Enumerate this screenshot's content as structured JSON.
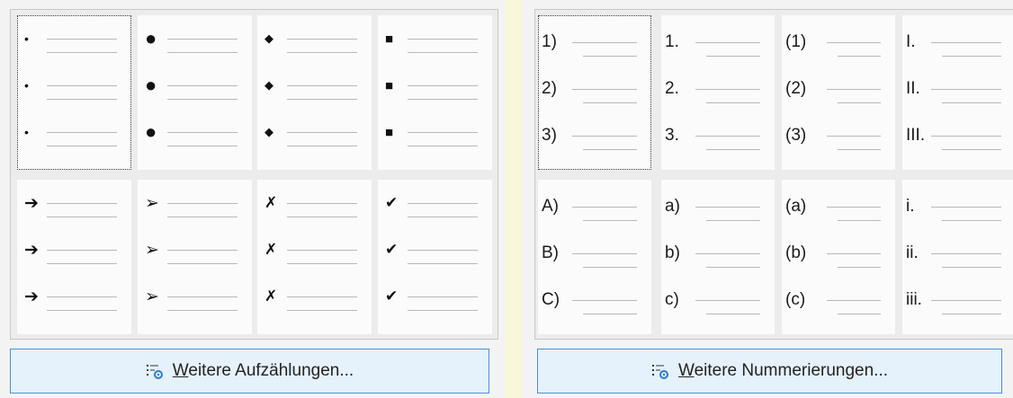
{
  "bullets": {
    "rows": [
      [
        {
          "name": "small-bullet",
          "marker": "•"
        },
        {
          "name": "large-bullet",
          "marker": "●"
        },
        {
          "name": "diamond-bullet",
          "marker": "◆"
        },
        {
          "name": "square-bullet",
          "marker": "■"
        }
      ],
      [
        {
          "name": "arrow-bullet",
          "marker": "➔"
        },
        {
          "name": "arrowhead-bullet",
          "marker": "➢"
        },
        {
          "name": "cross-bullet",
          "marker": "✗"
        },
        {
          "name": "checkmark-bullet",
          "marker": "✔"
        }
      ]
    ],
    "button": {
      "mnemonic": "W",
      "rest": "eitere Aufzählungen..."
    }
  },
  "numbering": {
    "rows": [
      [
        {
          "name": "numbering-paren-number",
          "items": [
            "1)",
            "2)",
            "3)"
          ]
        },
        {
          "name": "numbering-dot-number",
          "items": [
            "1.",
            "2.",
            "3."
          ]
        },
        {
          "name": "numbering-parens-number",
          "items": [
            "(1)",
            "(2)",
            "(3)"
          ]
        },
        {
          "name": "numbering-upper-roman",
          "items": [
            "I.",
            "II.",
            "III."
          ]
        }
      ],
      [
        {
          "name": "numbering-upper-letter",
          "items": [
            "A)",
            "B)",
            "C)"
          ]
        },
        {
          "name": "numbering-lower-letter",
          "items": [
            "a)",
            "b)",
            "c)"
          ]
        },
        {
          "name": "numbering-parens-lower-letter",
          "items": [
            "(a)",
            "(b)",
            "(c)"
          ]
        },
        {
          "name": "numbering-lower-roman",
          "items": [
            "i.",
            "ii.",
            "iii."
          ]
        }
      ]
    ],
    "button": {
      "mnemonic": "W",
      "rest": "eitere Nummerierungen..."
    }
  }
}
